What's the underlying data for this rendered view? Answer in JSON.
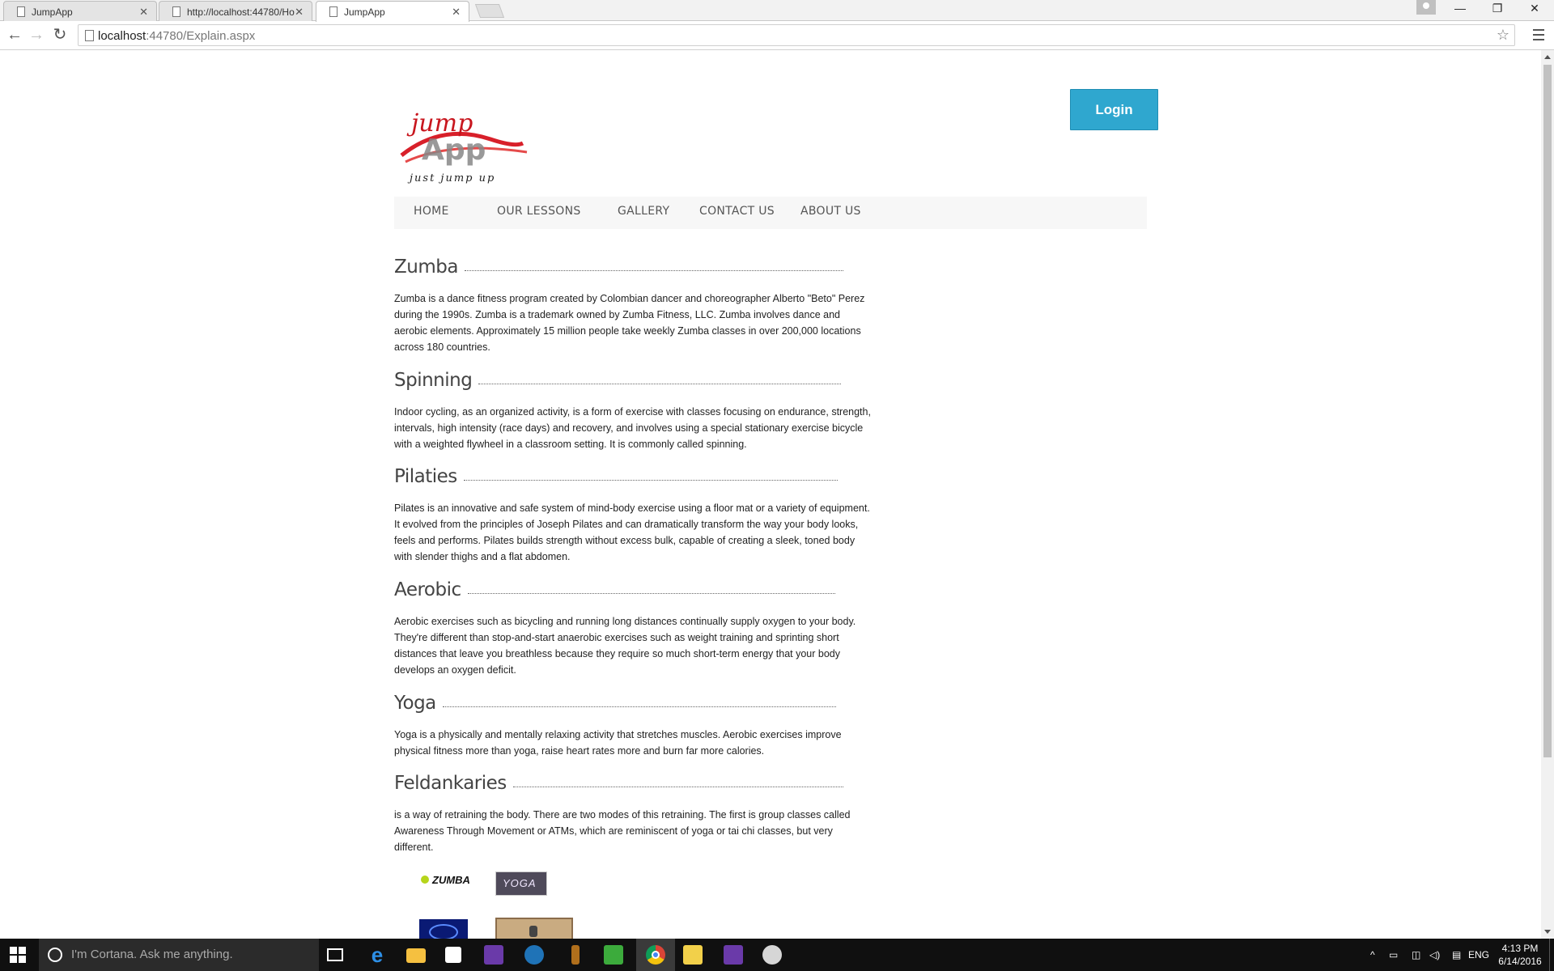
{
  "browser": {
    "tabs": [
      {
        "title": "JumpApp"
      },
      {
        "title": "http://localhost:44780/Ho"
      },
      {
        "title": "JumpApp"
      }
    ],
    "address": {
      "host": "localhost",
      "path": ":44780/Explain.aspx"
    }
  },
  "page": {
    "login_label": "Login",
    "logo": {
      "top_text": "jump",
      "mid_text": "App",
      "tagline": "just jump up"
    },
    "nav": [
      "HOME",
      "OUR LESSONS",
      "GALLERY",
      "CONTACT US",
      "ABOUT US"
    ],
    "sections": [
      {
        "title": "Zumba",
        "text": "Zumba is a dance fitness program created by Colombian dancer and choreographer Alberto \"Beto\" Perez during the 1990s. Zumba is a trademark owned by Zumba Fitness, LLC. Zumba involves dance and aerobic elements. Approximately 15 million people take weekly Zumba classes in over 200,000 locations across 180 countries."
      },
      {
        "title": "Spinning",
        "text": "Indoor cycling, as an organized activity, is a form of exercise with classes focusing on endurance, strength, intervals, high intensity (race days) and recovery, and involves using a special stationary exercise bicycle with a weighted flywheel in a classroom setting. It is commonly called spinning."
      },
      {
        "title": "Pilaties",
        "text": "Pilates is an innovative and safe system of mind-body exercise using a floor mat or a variety of equipment. It evolved from the principles of Joseph Pilates and can dramatically transform the way your body looks, feels and performs. Pilates builds strength without excess bulk, capable of creating a sleek, toned body with slender thighs and a flat abdomen."
      },
      {
        "title": "Aerobic",
        "text": "Aerobic exercises such as bicycling and running long distances continually supply oxygen to your body. They're different than stop-and-start anaerobic exercises such as weight training and sprinting short distances that leave you breathless because they require so much short-term energy that your body develops an oxygen deficit."
      },
      {
        "title": "Yoga",
        "text": "Yoga is a physically and mentally relaxing activity that stretches muscles. Aerobic exercises improve physical fitness more than yoga, raise heart rates more and burn far more calories."
      },
      {
        "title": "Feldankaries",
        "text": "is a way of retraining the body. There are two modes of this retraining. The first is group classes called Awareness Through Movement or ATMs, which are reminiscent of yoga or tai chi classes, but very different."
      }
    ],
    "thumbnails": {
      "zumba": "ZUMBA",
      "yoga": "YOGA"
    }
  },
  "taskbar": {
    "search_placeholder": "I'm Cortana. Ask me anything.",
    "language": "ENG",
    "time": "4:13 PM",
    "date": "6/14/2016"
  }
}
